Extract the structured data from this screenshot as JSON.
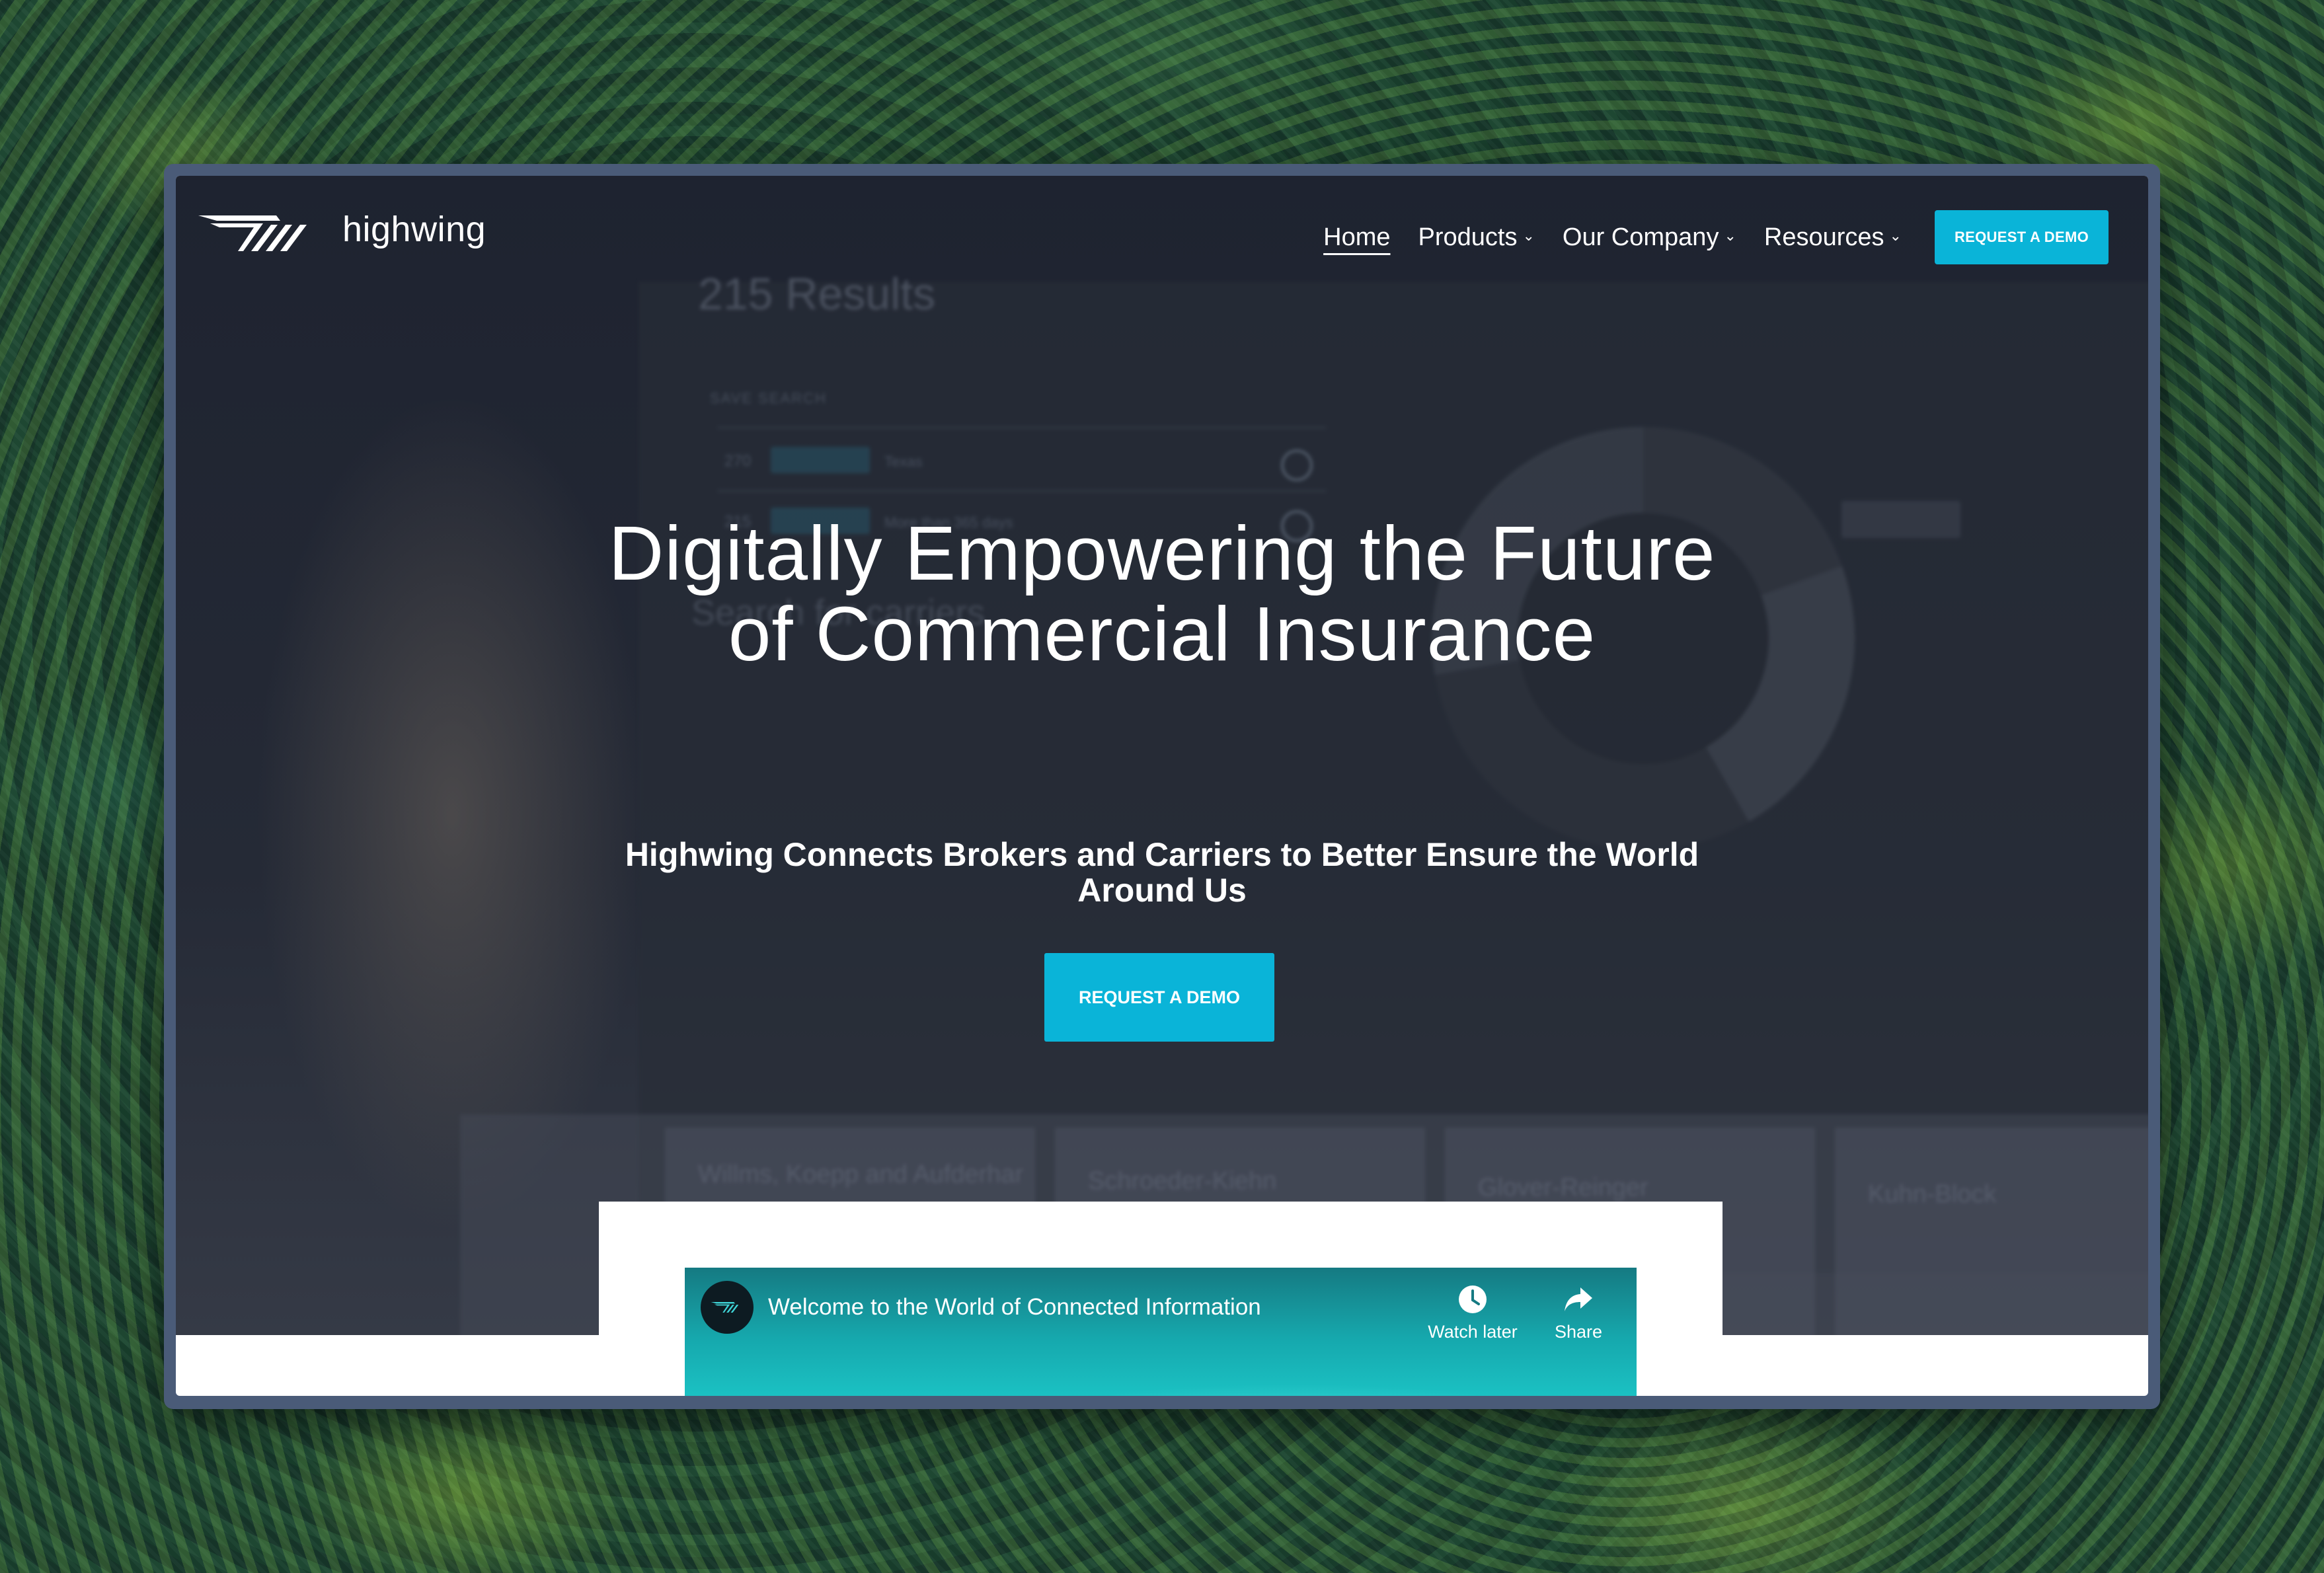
{
  "brand": {
    "name": "highwing"
  },
  "nav": {
    "items": [
      {
        "label": "Home",
        "active": true,
        "has_dropdown": false
      },
      {
        "label": "Products",
        "active": false,
        "has_dropdown": true
      },
      {
        "label": "Our Company",
        "active": false,
        "has_dropdown": true
      },
      {
        "label": "Resources",
        "active": false,
        "has_dropdown": true
      }
    ],
    "cta_label": "REQUEST A DEMO"
  },
  "hero": {
    "headline": "Digitally Empowering the Future of Commercial Insurance",
    "subheadline": "Highwing Connects Brokers and Carriers to Better Ensure the World Around Us",
    "cta_label": "REQUEST A DEMO",
    "background_text": {
      "results": "215 Results",
      "save_search": "SAVE SEARCH",
      "rows": [
        {
          "count": "270",
          "text": "Texas"
        },
        {
          "count": "215",
          "text": "More than 365 days"
        }
      ],
      "search_placeholder": "Search for carriers",
      "cards": [
        "Willms, Koepp and Aufderhar",
        "Schroeder-Kiehn",
        "Glover-Reinger",
        "Kuhn-Block"
      ]
    }
  },
  "video": {
    "title": "Welcome to the World of Connected Information",
    "actions": [
      {
        "label": "Watch later",
        "icon": "clock-icon"
      },
      {
        "label": "Share",
        "icon": "share-icon"
      }
    ]
  },
  "colors": {
    "accent": "#0ab4d8",
    "frame": "#4a5b78",
    "hero_bg": "#1e2330"
  }
}
